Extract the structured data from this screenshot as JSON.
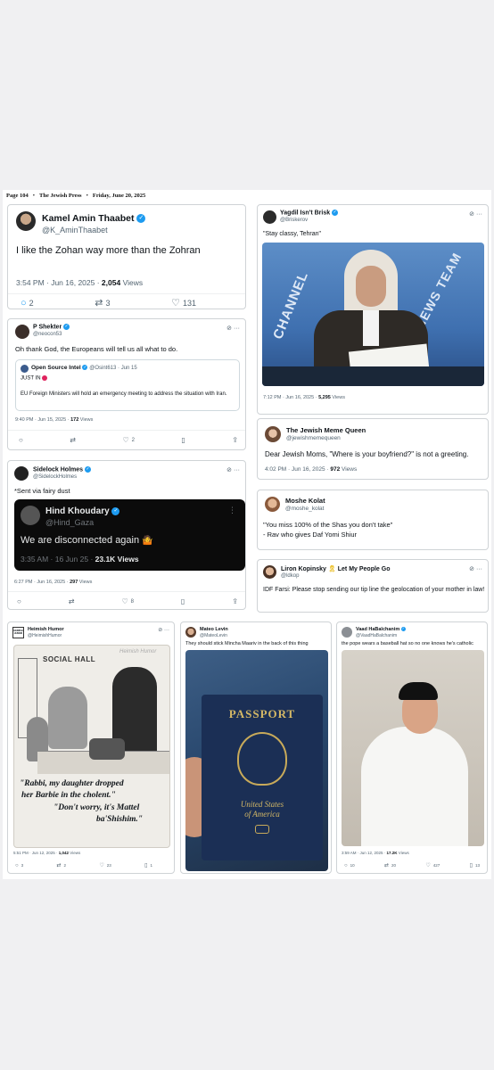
{
  "masthead": {
    "page": "Page 104",
    "paper": "The Jewish Press",
    "date": "Friday, June 20, 2025",
    "bullet": "•"
  },
  "icons": {
    "reply": "○",
    "retweet": "⇄",
    "like": "♡",
    "bookmark": "▯",
    "share": "⇪",
    "more": "···",
    "grok": "⊘",
    "verified": "✓"
  },
  "tweets": {
    "thaabet": {
      "name": "Kamel Amin Thaabet",
      "handle": "@K_AminThaabet",
      "text": "I like the Zohan way more than the Zohran",
      "time": "3:54 PM · Jun 16, 2025 · ",
      "views_count": "2,054",
      "views_label": " Views",
      "replies": "2",
      "retweets": "3",
      "likes": "131"
    },
    "brisk": {
      "name": "Yagdil Isn't Brisk",
      "handle": "@Briskerov",
      "text": "\"Stay classy, Tehran\"",
      "time": "7:12 PM · Jun 16, 2025 · ",
      "views_count": "5,295",
      "views_label": " Views",
      "sign1": "CHANNEL",
      "sign2": "NEWS TEAM"
    },
    "shekter": {
      "name": "P Shekter",
      "handle": "@neocon53",
      "text": "Oh thank God, the Europeans will tell us all what to do.",
      "time": "9:40 PM · Jun 15, 2025 · ",
      "views_count": "172",
      "views_label": " Views",
      "likes": "2",
      "quote": {
        "name": "Open Source Intel",
        "handle": "@Osint613 · Jun 15",
        "line1": "JUST IN",
        "line2": "EU Foreign Ministers will hold an emergency meeting to address the situation with Iran."
      }
    },
    "memequeen": {
      "name": "The Jewish Meme Queen",
      "handle": "@jewishmemequeen",
      "text": "Dear Jewish Moms, \"Where is your boyfriend?\" is not a greeting.",
      "time": "4:02 PM · Jun 16, 2025 · ",
      "views_count": "972",
      "views_label": " Views"
    },
    "holmes": {
      "name": "Sidelock Holmes",
      "handle": "@SidelockHolmes",
      "text": "*Sent via fairy dust",
      "time": "6:27 PM · Jun 16, 2025 · ",
      "views_count": "297",
      "views_label": " Views",
      "likes": "8",
      "embed": {
        "name": "Hind Khoudary",
        "handle": "@Hind_Gaza",
        "text": "We are disconnected again",
        "emoji": "🤷",
        "time": "3:35 AM · 16 Jun 25 · ",
        "views": "23.1K Views"
      }
    },
    "kolat": {
      "name": "Moshe Kolat",
      "handle": "@moshe_kolat",
      "line1": "\"You miss 100% of the Shas you don't take\"",
      "line2": "- Rav who gives Daf Yomi Shiur"
    },
    "kopinsky": {
      "name": "Liron Kopinsky",
      "name_suffix": "Let My People Go",
      "flag": "🎗",
      "handle": "@ldkop",
      "text": "IDF Farsi: Please stop sending our tip line the geolocation of your mother in law!"
    },
    "heimish": {
      "name": "Heimish Humor",
      "handle": "@HeimishHumor",
      "logo": "HEIMISH HUMOR",
      "hall": "SOCIAL HALL",
      "watermark": "Heimish Humor",
      "caption1": "\"Rabbi, my daughter dropped",
      "caption2": "her Barbie in the cholent.\"",
      "caption3": "\"Don't worry, it's Mattel",
      "caption4": "ba'Shishim.\"",
      "time": "5:51 PM · Jun 12, 2025 · ",
      "views_count": "1,042",
      "views_label": " Views",
      "replies": "3",
      "retweets": "2",
      "likes": "23",
      "bookmarks": "1"
    },
    "levin": {
      "name": "Mateo Levin",
      "handle": "@MateoLevin",
      "text": "They should stick Mincha Maariv in the back of this thing",
      "passport_title": "PASSPORT",
      "passport_sub1": "United States",
      "passport_sub2": "of America"
    },
    "baalchanim": {
      "name": "Vaad HaBalchanim",
      "handle": "@VaadHaBalchanim",
      "text": "the pope wears a baseball hat so no one knows he's catholic",
      "time": "3:59 AM · Jun 12, 2025 · ",
      "views_count": "17.2K",
      "views_label": " Views",
      "replies": "10",
      "retweets": "20",
      "likes": "427",
      "bookmarks": "13"
    }
  }
}
